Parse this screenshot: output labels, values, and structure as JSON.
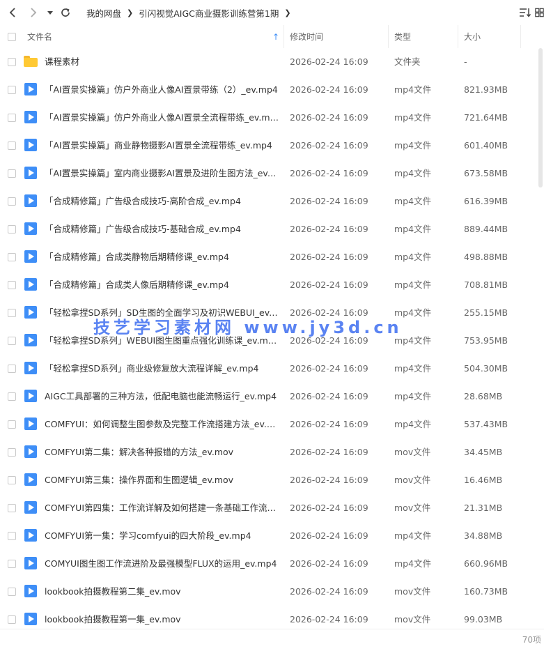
{
  "toolbar": {
    "breadcrumb": [
      "我的网盘",
      "引闪视觉AIGC商业摄影训练营第1期"
    ],
    "back_icon": "chevron-left-icon",
    "forward_icon": "chevron-right-icon",
    "history_icon": "caret-down-icon",
    "refresh_icon": "refresh-icon",
    "sort_icon": "sort-list-icon",
    "view_icon": "grid-view-icon"
  },
  "columns": {
    "name": "文件名",
    "modified": "修改时间",
    "type": "类型",
    "size": "大小",
    "sort_indicator": "↑"
  },
  "files": [
    {
      "name": "课程素材",
      "modified": "2026-02-24 16:09",
      "type": "文件夹",
      "size": "-",
      "icon": "folder-icon"
    },
    {
      "name": "「AI置景实操篇」仿户外商业人像AI置景带练（2）_ev.mp4",
      "modified": "2026-02-24 16:09",
      "type": "mp4文件",
      "size": "821.93MB",
      "icon": "video-file-icon"
    },
    {
      "name": "「AI置景实操篇」仿户外商业人像AI置景全流程带练_ev.mp4",
      "modified": "2026-02-24 16:09",
      "type": "mp4文件",
      "size": "721.64MB",
      "icon": "video-file-icon"
    },
    {
      "name": "「AI置景实操篇」商业静物摄影AI置景全流程带练_ev.mp4",
      "modified": "2026-02-24 16:09",
      "type": "mp4文件",
      "size": "601.40MB",
      "icon": "video-file-icon"
    },
    {
      "name": "「AI置景实操篇」室内商业摄影AI置景及进阶生图方法_ev.m...",
      "modified": "2026-02-24 16:09",
      "type": "mp4文件",
      "size": "673.58MB",
      "icon": "video-file-icon"
    },
    {
      "name": "「合成精修篇」广告级合成技巧-高阶合成_ev.mp4",
      "modified": "2026-02-24 16:09",
      "type": "mp4文件",
      "size": "616.39MB",
      "icon": "video-file-icon"
    },
    {
      "name": "「合成精修篇」广告级合成技巧-基础合成_ev.mp4",
      "modified": "2026-02-24 16:09",
      "type": "mp4文件",
      "size": "889.44MB",
      "icon": "video-file-icon"
    },
    {
      "name": "「合成精修篇」合成类静物后期精修课_ev.mp4",
      "modified": "2026-02-24 16:09",
      "type": "mp4文件",
      "size": "498.88MB",
      "icon": "video-file-icon"
    },
    {
      "name": "「合成精修篇」合成类人像后期精修课_ev.mp4",
      "modified": "2026-02-24 16:09",
      "type": "mp4文件",
      "size": "708.81MB",
      "icon": "video-file-icon"
    },
    {
      "name": "「轻松拿捏SD系列」SD生图的全面学习及初识WEBUI_ev.m...",
      "modified": "2026-02-24 16:09",
      "type": "mp4文件",
      "size": "255.15MB",
      "icon": "video-file-icon"
    },
    {
      "name": "「轻松拿捏SD系列」WEBUI图生图重点强化训练课_ev.mp4",
      "modified": "2026-02-24 16:09",
      "type": "mp4文件",
      "size": "753.95MB",
      "icon": "video-file-icon"
    },
    {
      "name": "「轻松拿捏SD系列」商业级修复放大流程详解_ev.mp4",
      "modified": "2026-02-24 16:09",
      "type": "mp4文件",
      "size": "504.30MB",
      "icon": "video-file-icon"
    },
    {
      "name": "AIGC工具部署的三种方法，低配电脑也能流畅运行_ev.mp4",
      "modified": "2026-02-24 16:09",
      "type": "mp4文件",
      "size": "28.68MB",
      "icon": "video-file-icon"
    },
    {
      "name": "COMFYUI：如何调整生图参数及完整工作流搭建方法_ev.mp4",
      "modified": "2026-02-24 16:09",
      "type": "mp4文件",
      "size": "537.43MB",
      "icon": "video-file-icon"
    },
    {
      "name": "COMFYUI第二集：解决各种报错的方法_ev.mov",
      "modified": "2026-02-24 16:09",
      "type": "mov文件",
      "size": "34.45MB",
      "icon": "video-file-icon"
    },
    {
      "name": "COMFYUI第三集：操作界面和生图逻辑_ev.mov",
      "modified": "2026-02-24 16:09",
      "type": "mov文件",
      "size": "16.46MB",
      "icon": "video-file-icon"
    },
    {
      "name": "COMFYUI第四集：工作流详解及如何搭建一条基础工作流_e...",
      "modified": "2026-02-24 16:09",
      "type": "mov文件",
      "size": "21.31MB",
      "icon": "video-file-icon"
    },
    {
      "name": "COMFYUI第一集：学习comfyui的四大阶段_ev.mp4",
      "modified": "2026-02-24 16:09",
      "type": "mp4文件",
      "size": "34.88MB",
      "icon": "video-file-icon"
    },
    {
      "name": "COMYUI图生图工作流进阶及最强模型FLUX的运用_ev.mp4",
      "modified": "2026-02-24 16:09",
      "type": "mp4文件",
      "size": "660.96MB",
      "icon": "video-file-icon"
    },
    {
      "name": "lookbook拍摄教程第二集_ev.mov",
      "modified": "2026-02-24 16:09",
      "type": "mov文件",
      "size": "160.73MB",
      "icon": "video-file-icon"
    },
    {
      "name": "lookbook拍摄教程第一集_ev.mov",
      "modified": "2026-02-24 16:09",
      "type": "mov文件",
      "size": "99.03MB",
      "icon": "video-file-icon"
    }
  ],
  "footer": {
    "count": "70项"
  },
  "watermark": "技艺学习素材网 www.jy3d.cn",
  "colors": {
    "accent": "#3e8ef7",
    "folder": "#ffc934",
    "watermark": "#3e6ef0"
  }
}
